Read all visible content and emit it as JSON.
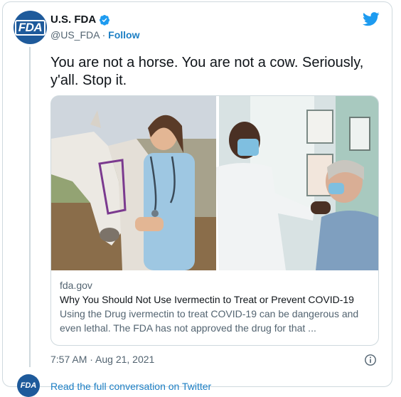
{
  "author": {
    "name": "U.S. FDA",
    "handle": "@US_FDA",
    "separator": "·",
    "follow_label": "Follow",
    "avatar_text": "FDA"
  },
  "tweet": {
    "text": "You are not a horse. You are not a cow. Seriously, y'all. Stop it."
  },
  "link_card": {
    "domain": "fda.gov",
    "title": "Why You Should Not Use Ivermectin to Treat or Prevent COVID-19",
    "description": "Using the Drug ivermectin to treat COVID-19 can be dangerous and even lethal. The FDA has not approved the drug for that ..."
  },
  "timestamp": "7:57 AM · Aug 21, 2021",
  "footer": {
    "link_text": "Read the full conversation on Twitter",
    "avatar_text": "FDA"
  },
  "icons": {
    "verified": "verified-badge-icon",
    "twitter": "twitter-bird-icon",
    "info": "info-icon"
  },
  "colors": {
    "brand_blue": "#1d9bf0",
    "link_blue": "#1d7fc4",
    "fda_blue": "#1e5a9b",
    "secondary_text": "#536471",
    "border": "#cfd9de"
  }
}
